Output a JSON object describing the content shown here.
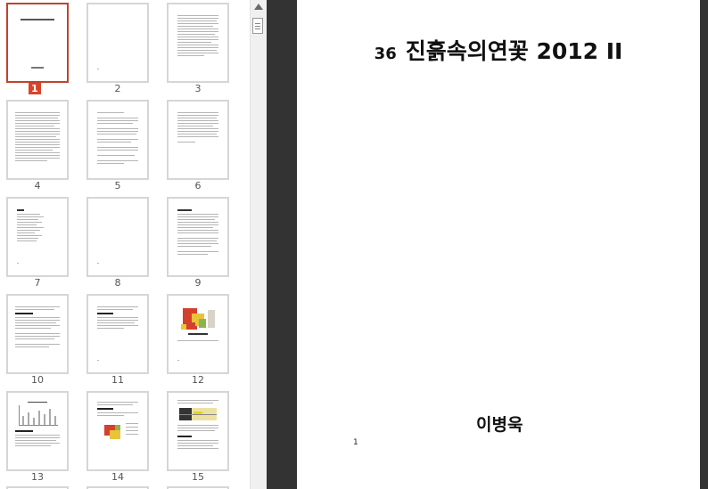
{
  "thumbnails": [
    {
      "label": "1",
      "selected": true
    },
    {
      "label": "2"
    },
    {
      "label": "3"
    },
    {
      "label": "4"
    },
    {
      "label": "5"
    },
    {
      "label": "6"
    },
    {
      "label": "7"
    },
    {
      "label": "8"
    },
    {
      "label": "9"
    },
    {
      "label": "10"
    },
    {
      "label": "11"
    },
    {
      "label": "12"
    },
    {
      "label": "13"
    },
    {
      "label": "14"
    },
    {
      "label": "15"
    }
  ],
  "document_page": {
    "volume": "36",
    "title": "진흙속의연꽃 2012 II",
    "author": "이병욱",
    "page_number": "1"
  },
  "colors": {
    "selected_border": "#c0432b",
    "selected_badge": "#d9442a",
    "viewer_background": "#333333"
  }
}
